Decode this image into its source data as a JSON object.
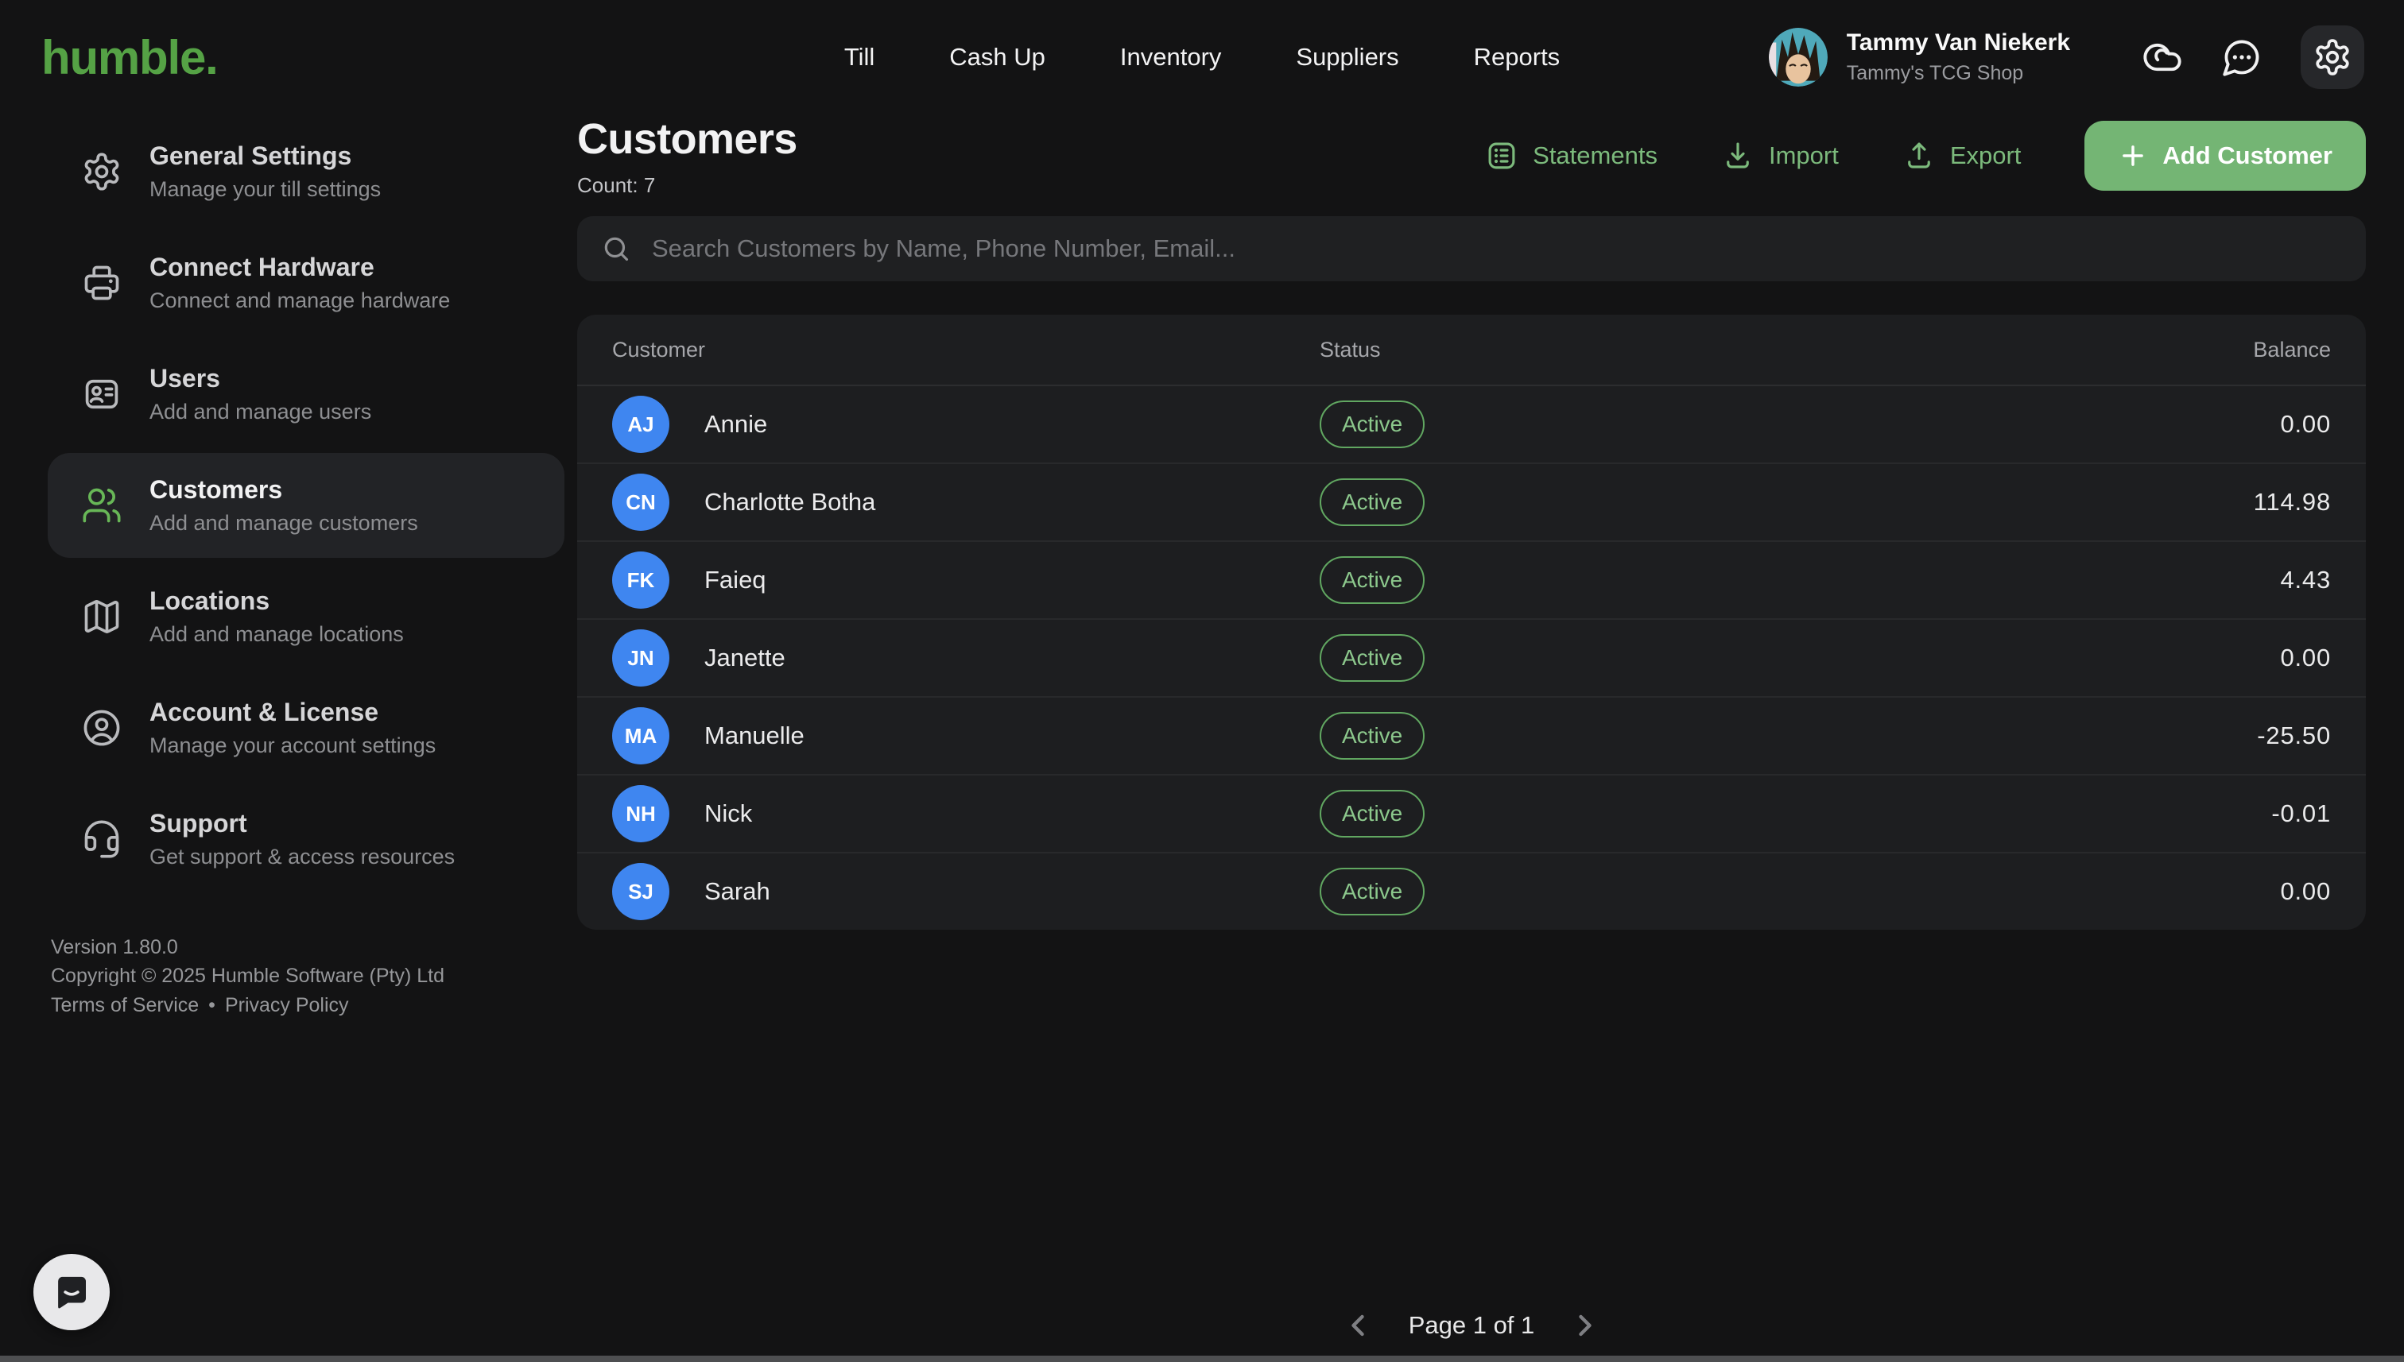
{
  "brand": {
    "logo": "humble."
  },
  "top_nav": {
    "items": [
      "Till",
      "Cash Up",
      "Inventory",
      "Suppliers",
      "Reports"
    ]
  },
  "user": {
    "name": "Tammy Van Niekerk",
    "org": "Tammy's TCG Shop"
  },
  "header_icons": [
    "cloud-sync-icon",
    "messages-icon",
    "gear-icon"
  ],
  "sidebar": {
    "items": [
      {
        "id": "general-settings",
        "title": "General Settings",
        "subtitle": "Manage your till settings",
        "icon": "gear",
        "active": false
      },
      {
        "id": "connect-hardware",
        "title": "Connect Hardware",
        "subtitle": "Connect and manage hardware",
        "icon": "printer",
        "active": false
      },
      {
        "id": "users",
        "title": "Users",
        "subtitle": "Add and manage users",
        "icon": "id-card",
        "active": false
      },
      {
        "id": "customers",
        "title": "Customers",
        "subtitle": "Add and manage customers",
        "icon": "users",
        "active": true
      },
      {
        "id": "locations",
        "title": "Locations",
        "subtitle": "Add and manage locations",
        "icon": "map",
        "active": false
      },
      {
        "id": "account-license",
        "title": "Account & License",
        "subtitle": "Manage your account settings",
        "icon": "user-circle",
        "active": false
      },
      {
        "id": "support",
        "title": "Support",
        "subtitle": "Get support & access resources",
        "icon": "headset",
        "active": false
      }
    ]
  },
  "page": {
    "title": "Customers",
    "count_label": "Count: 7"
  },
  "actions": {
    "statements": "Statements",
    "import": "Import",
    "export": "Export",
    "add_customer": "Add Customer"
  },
  "search": {
    "placeholder": "Search Customers by Name, Phone Number, Email..."
  },
  "table": {
    "columns": [
      "Customer",
      "Status",
      "Balance"
    ],
    "rows": [
      {
        "initials": "AJ",
        "name": "Annie",
        "status": "Active",
        "balance": "0.00"
      },
      {
        "initials": "CN",
        "name": "Charlotte Botha",
        "status": "Active",
        "balance": "114.98"
      },
      {
        "initials": "FK",
        "name": "Faieq",
        "status": "Active",
        "balance": "4.43"
      },
      {
        "initials": "JN",
        "name": "Janette",
        "status": "Active",
        "balance": "0.00"
      },
      {
        "initials": "MA",
        "name": "Manuelle",
        "status": "Active",
        "balance": "-25.50"
      },
      {
        "initials": "NH",
        "name": "Nick",
        "status": "Active",
        "balance": "-0.01"
      },
      {
        "initials": "SJ",
        "name": "Sarah",
        "status": "Active",
        "balance": "0.00"
      }
    ]
  },
  "pagination": {
    "label": "Page 1 of 1"
  },
  "footer": {
    "version": "Version 1.80.0",
    "copyright": "Copyright © 2025 Humble Software (Pty) Ltd",
    "terms": "Terms of Service",
    "separator": "•",
    "privacy": "Privacy Policy"
  },
  "colors": {
    "logo_green": "#55a245",
    "accent_green": "#7cba7c",
    "button_green": "#74b574",
    "status_green": "#8cc88c",
    "avatar_blue": "#3f86f0",
    "background": "#131314",
    "panel": "#1d1e20"
  }
}
